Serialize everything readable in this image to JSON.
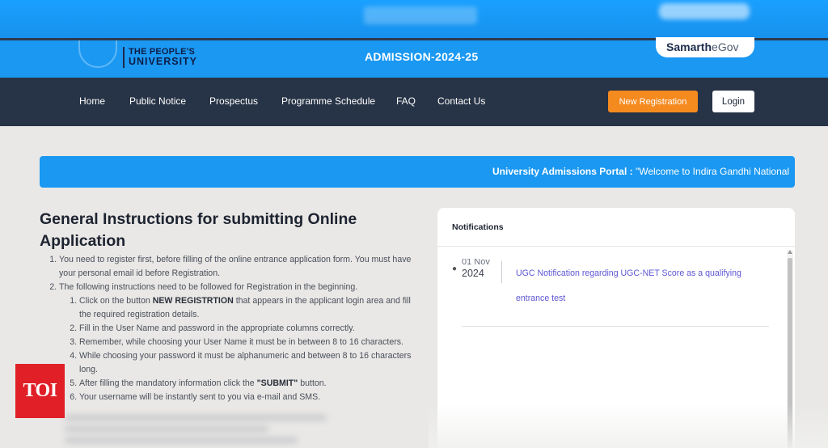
{
  "header": {
    "logo_line1": "THE PEOPLE'S",
    "logo_line2": "UNIVERSITY",
    "admission_title": "ADMISSION-2024-25",
    "samarth_brand": "Samarth",
    "samarth_suffix": "eGov"
  },
  "nav": {
    "items": [
      "Home",
      "Public Notice",
      "Prospectus",
      "Programme Schedule",
      "FAQ",
      "Contact Us"
    ],
    "new_registration_label": "New Registration",
    "login_label": "Login"
  },
  "marquee": {
    "prefix": "University Admissions Portal :",
    "text": "\"Welcome to Indira Gandhi National"
  },
  "instructions": {
    "title": "General Instructions for submitting Online Application",
    "item1": "You need to register first, before filling of the online entrance application form. You must have your personal email id before Registration.",
    "item2": "The following instructions need to be followed for Registration in the beginning.",
    "sub1_pre": "Click on the button ",
    "sub1_bold": "NEW REGISTRTION",
    "sub1_post": " that appears in the applicant login area and fill the required registration details.",
    "sub2": "Fill in the User Name and password in the appropriate columns correctly.",
    "sub3": "Remember, while choosing your User Name it must be in between 8 to 16 characters.",
    "sub4": "While choosing your password it must be alphanumeric and between 8 to 16 characters long.",
    "sub5_pre": "After filling the mandatory information click the ",
    "sub5_bold": "\"SUBMIT\"",
    "sub5_post": " button.",
    "sub6": "Your username will be instantly sent to you via e-mail and SMS."
  },
  "notifications": {
    "heading": "Notifications",
    "items": [
      {
        "date_line1": "01 Nov",
        "date_line2": "2024",
        "text": "UGC Notification regarding UGC-NET Score as a qualifying entrance test"
      }
    ]
  },
  "watermark": {
    "label": "TOI"
  },
  "colors": {
    "primary_blue": "#1a98f2",
    "nav_dark": "#273346",
    "accent_orange": "#f58a1f",
    "link_purple": "#5d57d3",
    "toi_red": "#e01f26"
  }
}
